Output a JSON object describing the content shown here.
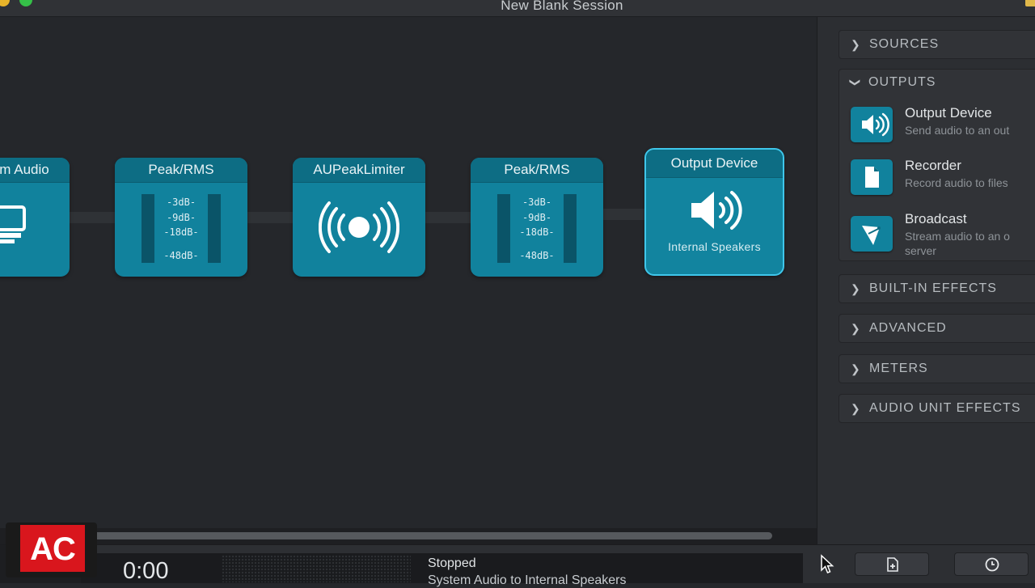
{
  "window": {
    "title": "New Blank Session"
  },
  "nodes": [
    {
      "title": "m Audio",
      "type": "source"
    },
    {
      "title": "Peak/RMS",
      "db_labels": [
        "-3dB-",
        "-9dB-",
        "-18dB-",
        "-48dB-"
      ]
    },
    {
      "title": "AUPeakLimiter"
    },
    {
      "title": "Peak/RMS",
      "db_labels": [
        "-3dB-",
        "-9dB-",
        "-18dB-",
        "-48dB-"
      ]
    },
    {
      "title": "Output Device",
      "subtitle": "Internal Speakers",
      "selected": true
    }
  ],
  "panel": {
    "sources": "SOURCES",
    "outputs": "OUTPUTS",
    "output_items": [
      {
        "name": "Output Device",
        "desc": "Send audio to an out",
        "icon": "speaker-icon"
      },
      {
        "name": "Recorder",
        "desc": "Record audio to files",
        "icon": "file-icon"
      },
      {
        "name": "Broadcast",
        "desc": "Stream audio to an o server",
        "icon": "satellite-dish-icon"
      }
    ],
    "built_in_effects": "BUILT-IN EFFECTS",
    "advanced": "ADVANCED",
    "meters": "METERS",
    "audio_unit_effects": "AUDIO UNIT EFFECTS"
  },
  "transport": {
    "time": "0:00",
    "status": "Stopped",
    "route": "System Audio to Internal Speakers"
  },
  "logo": {
    "text": "AC"
  },
  "colors": {
    "node": "#11829d",
    "node_header": "#0d6d84",
    "selected_border": "#3fc6ea",
    "background": "#25272b"
  }
}
